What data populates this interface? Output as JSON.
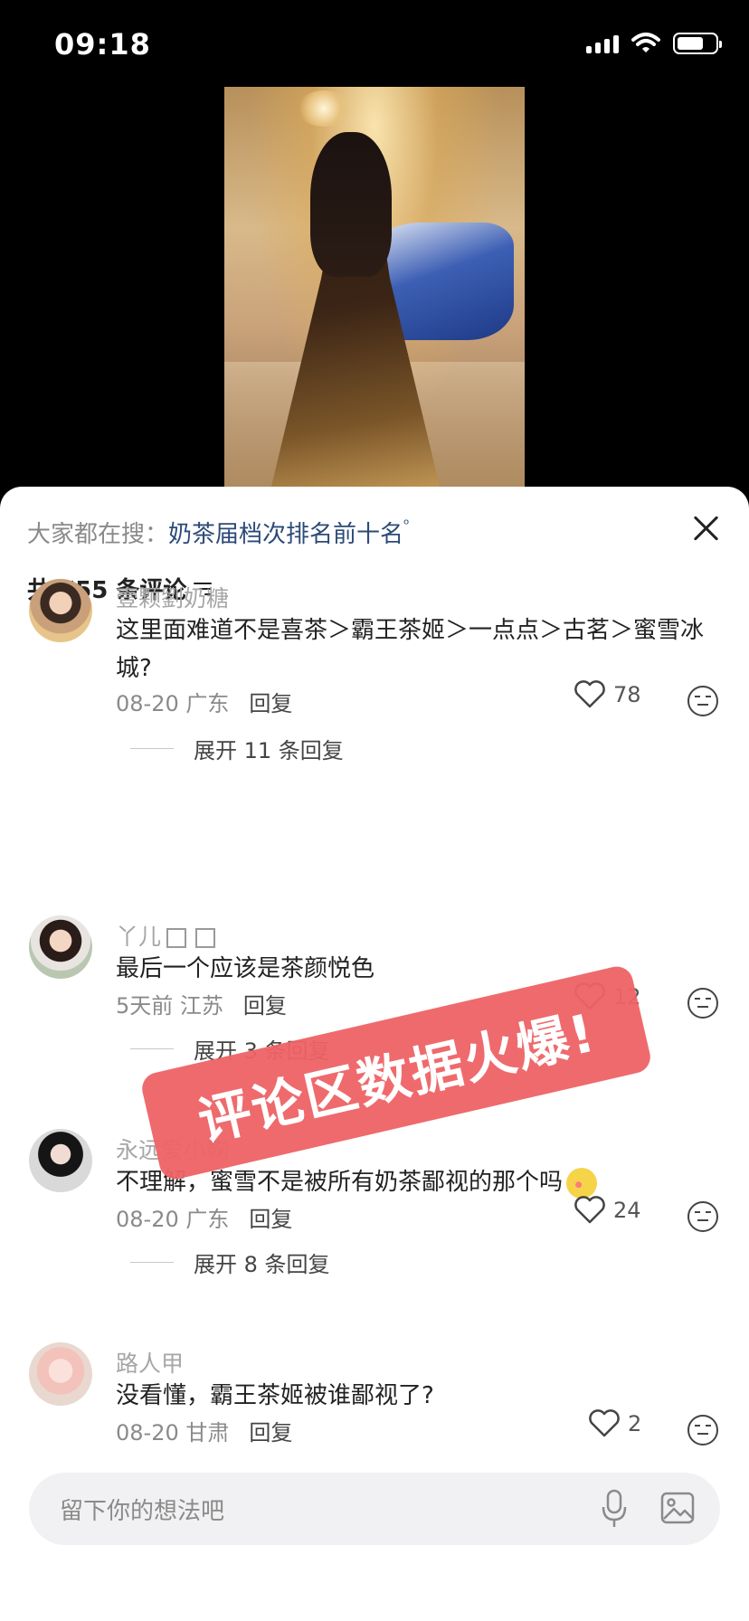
{
  "status_bar": {
    "time": "09:18"
  },
  "search_hint": {
    "label": "大家都在搜：",
    "query": "奶茶届档次排名前十名"
  },
  "comments_header": {
    "count_text": "共 755 条评论"
  },
  "comments": [
    {
      "username": "壹颗劉奶糖",
      "text": "这里面难道不是喜茶＞霸王茶姬＞一点点＞古茗＞蜜雪冰城?",
      "date": "08-20",
      "location": "广东",
      "reply_label": "回复",
      "likes": "78",
      "expand_text": "展开 11 条回复"
    },
    {
      "username": "丫儿",
      "text": "最后一个应该是茶颜悦色",
      "date": "5天前",
      "location": "江苏",
      "reply_label": "回复",
      "likes": "12",
      "expand_text": "展开 3 条回复"
    },
    {
      "username": "永远爱小鞠",
      "text": "不理解，蜜雪不是被所有奶茶鄙视的那个吗",
      "date": "08-20",
      "location": "广东",
      "reply_label": "回复",
      "likes": "24",
      "expand_text": "展开 8 条回复"
    },
    {
      "username": "路人甲",
      "text": "没看懂，霸王茶姬被谁鄙视了?",
      "date": "08-20",
      "location": "甘肃",
      "reply_label": "回复",
      "likes": "2"
    }
  ],
  "overlay_banner": {
    "text": "评论区数据火爆!",
    "color": "#ef6366"
  },
  "input_bar": {
    "placeholder": "留下你的想法吧"
  },
  "icons": [
    "signal-icon",
    "wifi-icon",
    "battery-icon",
    "close-icon",
    "filter-icon",
    "heart-icon",
    "emoji-icon",
    "mic-icon",
    "image-icon"
  ]
}
